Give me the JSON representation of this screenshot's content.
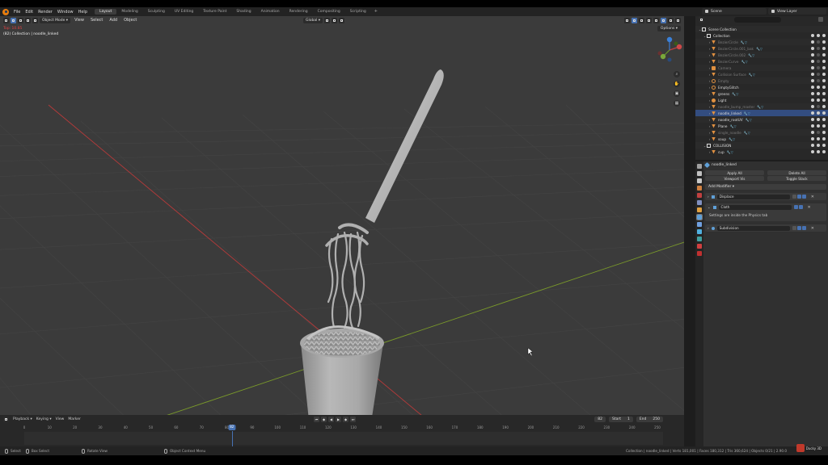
{
  "menu": {
    "items": [
      "File",
      "Edit",
      "Render",
      "Window",
      "Help"
    ]
  },
  "workspaces": {
    "tabs": [
      "Layout",
      "Modeling",
      "Sculpting",
      "UV Editing",
      "Texture Paint",
      "Shading",
      "Animation",
      "Rendering",
      "Compositing",
      "Scripting"
    ],
    "active": "Layout",
    "add_label": "+"
  },
  "scene": {
    "label": "Scene"
  },
  "view_layer": {
    "label": "View Layer"
  },
  "viewport": {
    "mode": "Object Mode",
    "menus": [
      "View",
      "Select",
      "Add",
      "Object"
    ],
    "transform_orientation": "Global",
    "options_label": "Options",
    "info_line1": "Top: 10.85",
    "info_line2": "(82) Collection | noodle_linked"
  },
  "timeline": {
    "menus": [
      "Playback",
      "Keying",
      "View",
      "Marker"
    ],
    "current_frame": "82",
    "start_label": "Start",
    "start_value": "1",
    "end_label": "End",
    "end_value": "250",
    "ticks": [
      "0",
      "10",
      "20",
      "30",
      "40",
      "50",
      "60",
      "70",
      "80",
      "90",
      "100",
      "110",
      "120",
      "130",
      "140",
      "150",
      "160",
      "170",
      "180",
      "190",
      "200",
      "210",
      "220",
      "230",
      "240",
      "250"
    ]
  },
  "outliner": {
    "rows": [
      {
        "label": "Scene Collection",
        "icon": "collection",
        "indent": 0,
        "dim": false,
        "vis": false
      },
      {
        "label": "Collection",
        "icon": "collection",
        "indent": 1,
        "dim": false,
        "vis": true
      },
      {
        "label": "BezierCircle",
        "icon": "mesh",
        "indent": 2,
        "dim": true,
        "vis": true
      },
      {
        "label": "BezierCircle.001_bak",
        "icon": "mesh",
        "indent": 2,
        "dim": true,
        "vis": true
      },
      {
        "label": "BezierCircle.002",
        "icon": "mesh",
        "indent": 2,
        "dim": true,
        "vis": true
      },
      {
        "label": "BezierCurve",
        "icon": "mesh",
        "indent": 2,
        "dim": true,
        "vis": true
      },
      {
        "label": "Camera",
        "icon": "camera",
        "indent": 2,
        "dim": true,
        "vis": true
      },
      {
        "label": "Collision Surface",
        "icon": "mesh",
        "indent": 2,
        "dim": true,
        "vis": true
      },
      {
        "label": "Empty",
        "icon": "empty",
        "indent": 2,
        "dim": true,
        "vis": true
      },
      {
        "label": "EmptyGlitch",
        "icon": "empty",
        "indent": 2,
        "dim": false,
        "vis": true
      },
      {
        "label": "greens",
        "icon": "mesh",
        "indent": 2,
        "dim": false,
        "vis": true
      },
      {
        "label": "Light",
        "icon": "light",
        "indent": 2,
        "dim": false,
        "vis": true
      },
      {
        "label": "noodle_bump_master",
        "icon": "mesh",
        "indent": 2,
        "dim": true,
        "vis": true
      },
      {
        "label": "noodle_linked",
        "icon": "mesh",
        "indent": 2,
        "dim": false,
        "vis": true,
        "selected": true
      },
      {
        "label": "noodle_rootUV",
        "icon": "mesh",
        "indent": 2,
        "dim": false,
        "vis": true
      },
      {
        "label": "Plane",
        "icon": "mesh",
        "indent": 2,
        "dim": false,
        "vis": true
      },
      {
        "label": "single_noodle",
        "icon": "mesh",
        "indent": 2,
        "dim": true,
        "vis": true
      },
      {
        "label": "soup",
        "icon": "mesh",
        "indent": 2,
        "dim": false,
        "vis": true
      },
      {
        "label": "COLLISION",
        "icon": "collection",
        "indent": 1,
        "dim": false,
        "vis": true
      },
      {
        "label": "cup",
        "icon": "mesh",
        "indent": 2,
        "dim": false,
        "vis": true
      }
    ]
  },
  "properties": {
    "object_name": "noodle_linked",
    "ops": [
      "Apply All",
      "Delete All",
      "Viewport Vis",
      "Toggle Stack"
    ],
    "add_modifier_label": "Add Modifier",
    "modifiers": [
      {
        "name": "Displace",
        "body": ""
      },
      {
        "name": "Cloth",
        "body": "Settings are inside the Physics tab"
      },
      {
        "name": "Subdivision",
        "body": ""
      }
    ],
    "tab_colors": [
      "#a0a0a0",
      "#c0c0c0",
      "#c8c8c8",
      "#d08040",
      "#c04040",
      "#8090c0",
      "#e0a040",
      "#5fa0d8",
      "#70a0e0",
      "#50b0e0",
      "#40a0a0",
      "#d04040",
      "#c03030"
    ]
  },
  "statusbar": {
    "select": "Select",
    "box_select": "Box Select",
    "rotate_view": "Rotate View",
    "context_menu": "Object Context Menu",
    "stats": "Collection | noodle_linked | Verts 181,001 | Faces 180,312 | Tris 360,624 | Objects 0/21 | 2.90.0",
    "brand": "Ducky 3D"
  },
  "colors": {
    "accent": "#4772b3",
    "viewport_bg": "#3b3b3b",
    "x_axis": "#b83a3a",
    "y_axis": "#7a9a2a"
  }
}
